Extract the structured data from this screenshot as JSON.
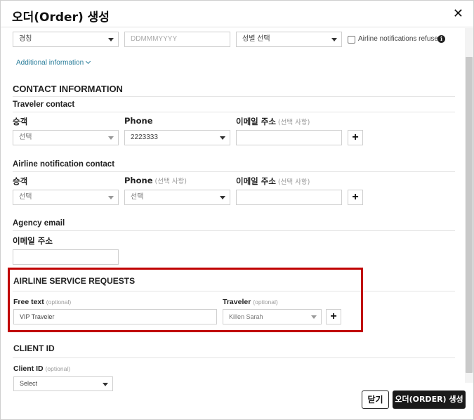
{
  "header": {
    "title": "오더(Order) 생성",
    "close_glyph": "✕"
  },
  "top_row": {
    "title_select": "경칭",
    "dob_placeholder": "DDMMMYYYY",
    "gender_select": "성별 선택",
    "notifications_refused_label": "Airline notifications refused",
    "info_glyph": "i"
  },
  "additional_info_link": "Additional information",
  "contact": {
    "section_title": "CONTACT INFORMATION",
    "traveler_contact": {
      "title": "Traveler contact",
      "passenger_label": "승객",
      "passenger_value": "선택",
      "phone_label": "Phone",
      "phone_value": "2223333",
      "email_label": "이메일 주소",
      "email_optional": "(선택 사항)",
      "email_value": "",
      "add_glyph": "+"
    },
    "airline_notification_contact": {
      "title": "Airline notification contact",
      "passenger_label": "승객",
      "passenger_value": "선택",
      "phone_label": "Phone",
      "phone_optional": "(선택 사항)",
      "phone_value": "선택",
      "email_label": "이메일 주소",
      "email_optional": "(선택 사항)",
      "email_value": "",
      "add_glyph": "+"
    },
    "agency_email": {
      "title": "Agency email",
      "email_label": "이메일 주소",
      "email_value": ""
    }
  },
  "service_requests": {
    "section_title": "AIRLINE SERVICE REQUESTS",
    "free_text_label": "Free text",
    "free_text_optional": "(optional)",
    "free_text_value": "VIP Traveler",
    "traveler_label": "Traveler",
    "traveler_optional": "(optional)",
    "traveler_value": "Killen Sarah",
    "add_glyph": "+",
    "highlight_color": "#c00000"
  },
  "client_id": {
    "section_title": "CLIENT ID",
    "label": "Client ID",
    "optional": "(optional)",
    "select_value": "Select"
  },
  "footer": {
    "close_label": "닫기",
    "create_label": "오더(ORDER) 생성"
  }
}
